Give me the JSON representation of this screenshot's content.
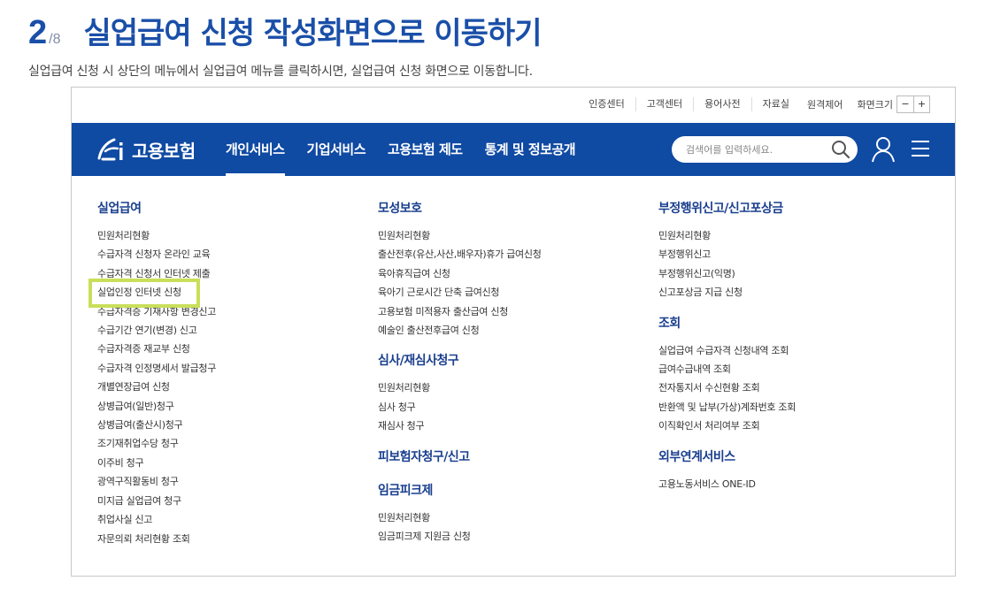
{
  "step": {
    "number": "2",
    "total": "/8",
    "title": "실업급여 신청 작성화면으로 이동하기",
    "description": "실업급여 신청 시 상단의 메뉴에서 실업급여 메뉴를 클릭하시면, 실업급여 신청 화면으로 이동합니다."
  },
  "utility": {
    "links": [
      "인증센터",
      "고객센터",
      "용어사전",
      "자료실"
    ],
    "remote": "원격제어",
    "zoom_label": "화면크기",
    "zoom_out": "−",
    "zoom_in": "+"
  },
  "nav": {
    "logo_text": "고용보험",
    "menu": [
      "개인서비스",
      "기업서비스",
      "고용보험 제도",
      "통계 및 정보공개"
    ],
    "active_index": 0,
    "search_placeholder": "검색어를 입력하세요."
  },
  "columns": {
    "col1": {
      "sections": [
        {
          "title": "실업급여",
          "items": [
            "민원처리현황",
            "수급자격 신청자 온라인 교육",
            "수급자격 신청서 인터넷 제출",
            "실업인정 인터넷 신청",
            "수급자격증 기재사항 변경신고",
            "수급기간 연기(변경) 신고",
            "수급자격증 재교부 신청",
            "수급자격 인정명세서 발급청구",
            "개별연장급여 신청",
            "상병급여(일반)청구",
            "상병급여(출산시)청구",
            "조기재취업수당 청구",
            "이주비 청구",
            "광역구직활동비 청구",
            "미지급 실업급여 청구",
            "취업사실 신고",
            "자문의뢰 처리현황 조회"
          ]
        }
      ]
    },
    "col2": {
      "sections": [
        {
          "title": "모성보호",
          "items": [
            "민원처리현황",
            "출산전후(유산,사산,배우자)휴가 급여신청",
            "육아휴직급여 신청",
            "육아기 근로시간 단축 급여신청",
            "고용보험 미적용자 출산급여 신청",
            "예술인 출산전후급여 신청"
          ]
        },
        {
          "title": "심사/재심사청구",
          "items": [
            "민원처리현황",
            "심사 청구",
            "재심사 청구"
          ]
        },
        {
          "title": "피보험자청구/신고",
          "items": []
        },
        {
          "title": "임금피크제",
          "items": [
            "민원처리현황",
            "임금피크제 지원금 신청"
          ]
        }
      ]
    },
    "col3": {
      "sections": [
        {
          "title": "부정행위신고/신고포상금",
          "items": [
            "민원처리현황",
            "부정행위신고",
            "부정행위신고(익명)",
            "신고포상금 지급 신청"
          ]
        },
        {
          "title": "조회",
          "items": [
            "실업급여 수급자격 신청내역 조회",
            "급여수급내역 조회",
            "전자통지서 수신현황 조회",
            "반환액 및 납부(가상)계좌번호 조회",
            "이직확인서 처리여부 조회"
          ]
        },
        {
          "title": "외부연계서비스",
          "items": [
            "고용노동서비스 ONE-ID"
          ]
        }
      ]
    }
  },
  "colors": {
    "brand_blue": "#0f4aa3",
    "title_blue": "#1a4fa8",
    "section_blue": "#1a3f8f",
    "highlight": "#c9df5a"
  },
  "highlighted_item": "실업인정 인터넷 신청"
}
